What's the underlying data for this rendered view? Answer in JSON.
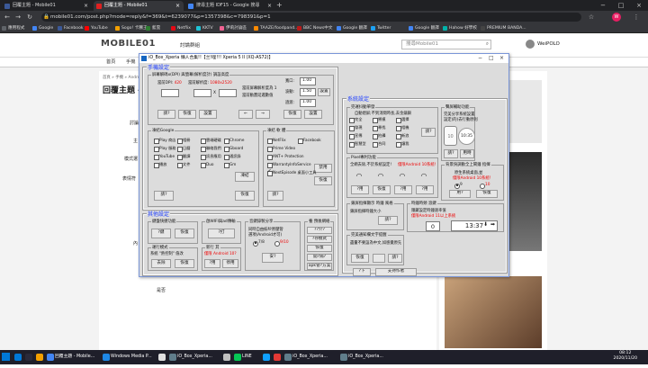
{
  "browser": {
    "tabs": [
      {
        "label": "回覆主題 - Mobile01",
        "active": false,
        "color": "#3b5998"
      },
      {
        "label": "回覆主題 - Mobile01",
        "active": true,
        "color": "#e02020"
      },
      {
        "label": "搜尋主題 IDF15 - Google 搜尋",
        "active": false,
        "color": "#4285f4"
      }
    ],
    "url": "mobile01.com/post.php?mode=reply&f=369&t=6239077&p=1357398&c=798391&p=1",
    "bookmarks": [
      {
        "label": "應用程式",
        "color": "#5f6368"
      },
      {
        "label": "Google",
        "color": "#4285f4"
      },
      {
        "label": "Facebook",
        "color": "#3b5998"
      },
      {
        "label": "YouTube",
        "color": "#ff0000"
      },
      {
        "label": "Sogo! 卡騰王",
        "color": "#f4a000"
      },
      {
        "label": "藍雲",
        "color": "#2e7d32"
      },
      {
        "label": "Netflix",
        "color": "#e50914"
      },
      {
        "label": "KKTV",
        "color": "#1ec3d6"
      },
      {
        "label": "伊莉討論區",
        "color": "#f06292"
      },
      {
        "label": "TAAZE/foodpand...",
        "color": "#ff8a00"
      },
      {
        "label": "BBC News中文",
        "color": "#bb1919"
      },
      {
        "label": "Google 翻譯",
        "color": "#4285f4"
      },
      {
        "label": "Twitter",
        "color": "#1da1f2"
      },
      {
        "label": "Google 翻譯",
        "color": "#4285f4"
      },
      {
        "label": "Hahow 好學校",
        "color": "#00b2a9"
      },
      {
        "label": "PREMIUM BANDA...",
        "color": "#444"
      }
    ]
  },
  "site": {
    "logo": "MOBILE01",
    "logo_accent": "01",
    "forum_title": "討論群組",
    "search_placeholder": "搜尋Mobile01",
    "username": "WeiPOLO",
    "nav": [
      "首頁",
      "手機",
      "相機",
      "筆電",
      "電腦",
      "蘋果",
      "影音",
      "汽車",
      "機車",
      "單車",
      "遊戲",
      "居家",
      "女性",
      "時尚",
      "運動",
      "生活",
      "遊戲",
      "閒聊",
      "時事",
      "悅遊日本"
    ],
    "breadcrumb": "首頁 » 手機 » Android » Sony / SE",
    "page_title": "回覆主題 -",
    "form_labels": [
      "討論",
      "主",
      "模式選",
      "表情符",
      "內"
    ],
    "footer_label": "是否"
  },
  "dialog": {
    "title": "iO_Box_Xperia 懶人合集!!【兰!哩!!! Xperia 5 II (XQ-AS72)】",
    "sec_mobile": {
      "title": "手機設定",
      "dpi": {
        "title": "屏幕解碼x(DPI) 與螢幕(解析度計)  調設高度",
        "dpi_label": "當前DPI:",
        "dpi_val": "420",
        "res_label": "當前解析度:",
        "res_val": "1080x2520",
        "hint": "當前屏幕解析度為 1",
        "q": "請?",
        "restore": "恢復",
        "set": "設置",
        "w_label": "寬口:",
        "w_val": "1.00",
        "ani_label": "波動:",
        "ani_val": "1.50",
        "trans_label": "過渡:",
        "trans_val": "1.00",
        "restore2": "恢復",
        "set2": "設置",
        "prev": "←",
        "next": "→",
        "hint2": "當前動畫延遲數值"
      },
      "google": {
        "title": "凍結Google",
        "opts": [
          "Play 商店",
          "相冊",
          "雲端硬碟",
          "Chrome",
          "Play 服務",
          "日曆",
          "聯絡我們",
          "Gboard",
          "YouTube",
          "翻譯",
          "訊息應用",
          "通訊錄",
          "播放",
          "文件",
          "Duo",
          "Gm"
        ],
        "btn_q": "請?",
        "btn_freeze": "凍結",
        "btn_restore": "恢復"
      },
      "apps": {
        "title": "凍結 軟 體",
        "opts": [
          "NetFlix",
          "Facebook",
          "Prime Video",
          "ANT+ Protection",
          "WarrantyInfoService",
          "NextEpisode 桌面小工具"
        ],
        "btn_q": "請?",
        "btn_disable": "禁用",
        "btn_restore": "恢復"
      }
    },
    "sec_misc": {
      "title": "其他設定",
      "g1": {
        "title": "鍵盤快捷功能",
        "btn1": "?鍵",
        "btn2": "恢復"
      },
      "g2": {
        "title": "啟WIFI與ad傳輸",
        "btn": "?打"
      },
      "g3": {
        "title": "啟動應用",
        "btn1": "?打",
        "btn2": "恢復"
      },
      "g4": {
        "title": "新行 其",
        "hint": "僅限 Android 10?",
        "btn1": "?用",
        "btn2": "停用"
      },
      "g5": {
        "title": "音鍵錄製分享",
        "line1": "同時自由紡紗原壓管",
        "line2": "選項(Android才可)",
        "r1": "7/8",
        "r2": "9/10",
        "btn": "安?"
      },
      "g6": {
        "title": "養 預後網絡",
        "b1": "??介?",
        "b2": "?存模式",
        "b3": "恢復",
        "b4": "開?隔?",
        "b5": "apk管?方案"
      },
      "g7": {
        "title": "運行模式",
        "hint": "系統 \"熱控制\" 值改",
        "btn1": "去除",
        "btn2": "恢復"
      }
    },
    "sec_sys": {
      "title": "系統設定",
      "sound": {
        "title": "完運抖動單發",
        "desc": "自動熄屏;不到消間時長,去金鑰鎖",
        "opts": [
          "完全",
          "禦模",
          "選擇",
          "發現",
          "尋找",
          "相機",
          "宣傳",
          "拍攝",
          "新浪",
          "智慧型",
          "合同",
          "讓我",
          "全屏",
          "錄音",
          "蓋板",
          "鏡光",
          "未燈",
          "抹除圖",
          "設定內存",
          "此預覽",
          "恢復雲",
          "狀態日誌",
          "通訊",
          "權限",
          "地址"
        ],
        "q": "請?"
      },
      "pixel": {
        "title": "Pixel專利功能",
        "hint1": "全網去除,不於系統設定!",
        "hint2": "僅限Android 10系統!",
        "b1": "?用",
        "b2": "恢復",
        "b3": "?用",
        "b4": "?用"
      },
      "led": {
        "title": "鎖屏指揮顯示 時鐘 風格",
        "hint": "鎖屏指揮時鐘大小",
        "btn": "請?"
      },
      "note": {
        "title": "完美通知欄文字提醒",
        "hint": "盡量不要設為中文,如感覺原先",
        "btn1": "恢復",
        "btn2": "",
        "q": "請?"
      },
      "side": {
        "title": "聲屏輔助功能",
        "line1": "完美分享系統設置",
        "line2": "設定(的)去行動原則",
        "time": "10",
        "timebox": "10:35",
        "b1": "請?",
        "b2": "用時"
      },
      "alarm": {
        "title": "背景快調動全上鬧鐘 指揮",
        "hint": "原生系統桌面,並",
        "hint2": "僅限Android 10系統！",
        "b1": "恢復",
        "b2": "用?"
      },
      "clockset": {
        "title": "時鐘時頻 滾鍵",
        "hint": "隱藏設定時鐘速率值",
        "hint2": "僅限Android 11以上系統",
        "val": "0",
        "time": "13:37",
        "down": "⬇",
        "right": "➡",
        "q": "請?"
      },
      "battery": {
        "title": "Xperia:Xbupp:轉換開啟",
        "hint": "僅限Android,僅限",
        "r1": "?",
        "r2": "轉",
        "b1": "安?",
        "b2": "恢復"
      }
    },
    "bottom": {
      "btn1": "?下",
      "btn2": "支持作者"
    }
  },
  "taskbar": {
    "items": [
      {
        "label": "",
        "color": "#0078d7"
      },
      {
        "label": "",
        "color": "#2a2a3a"
      },
      {
        "label": "",
        "color": "#f4a000"
      },
      {
        "label": "回覆主題 - Mobile...",
        "color": "#4285f4"
      },
      {
        "label": "Windows Media P...",
        "color": "#1e88e5"
      },
      {
        "label": "",
        "color": "#e0e0e0"
      },
      {
        "label": "iO_Box_Xperia...",
        "color": "#607d8b"
      },
      {
        "label": "",
        "color": "#c0c0c0"
      },
      {
        "label": "LINE",
        "color": "#06c755"
      },
      {
        "label": "",
        "color": "#0fa0ff"
      },
      {
        "label": "",
        "color": "#e53935"
      },
      {
        "label": "iO_Box_Xperia...",
        "color": "#607d8b"
      },
      {
        "label": "iO_Box_Xperia...",
        "color": "#607d8b"
      }
    ],
    "time": "08:12",
    "date": "2020/11/20"
  }
}
